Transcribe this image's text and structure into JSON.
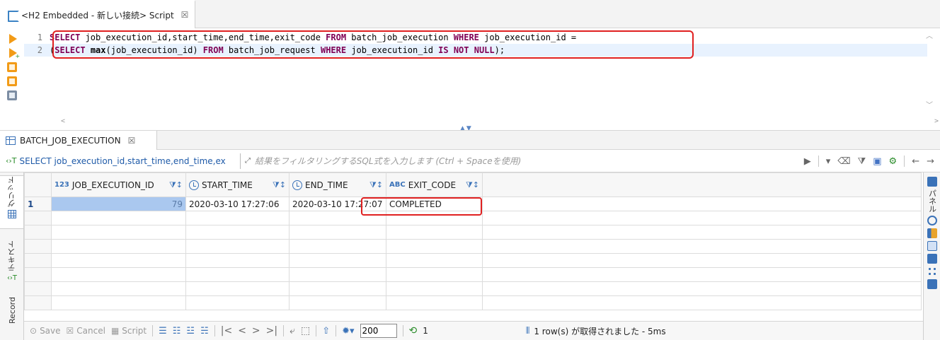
{
  "editor": {
    "tab_title": "<H2 Embedded - 新しい接続> Script",
    "close": "☒",
    "lines": [
      {
        "no": "1"
      },
      {
        "no": "2"
      }
    ]
  },
  "results": {
    "tab_title": "BATCH_JOB_EXECUTION",
    "close": "☒",
    "query_label": "SELECT job_execution_id,start_time,end_time,ex",
    "filter_placeholder": "結果をフィルタリングするSQL式を入力します (Ctrl + Spaceを使用)",
    "left_tabs": {
      "grid": "グリッド",
      "text": "テキスト",
      "record": "Record"
    },
    "right_tab": "パネル",
    "columns": [
      {
        "badge": "123",
        "name": "JOB_EXECUTION_ID"
      },
      {
        "badge": "",
        "name": "START_TIME"
      },
      {
        "badge": "",
        "name": "END_TIME"
      },
      {
        "badge": "ABC",
        "name": "EXIT_CODE"
      }
    ],
    "rows": [
      {
        "rn": "1",
        "job_execution_id": "79",
        "start_time": "2020-03-10 17:27:06",
        "end_time": "2020-03-10 17:27:07",
        "exit_code": "COMPLETED"
      }
    ]
  },
  "bottom_bar": {
    "save": "Save",
    "cancel": "Cancel",
    "script": "Script",
    "fetch_size": "200",
    "refresh_count": "1",
    "status": "1 row(s) が取得されました - 5ms"
  },
  "colors": {
    "highlight": "#e02020",
    "keyword": "#7f0055",
    "selection": "#aac8ef",
    "accent": "#3a72b8"
  }
}
